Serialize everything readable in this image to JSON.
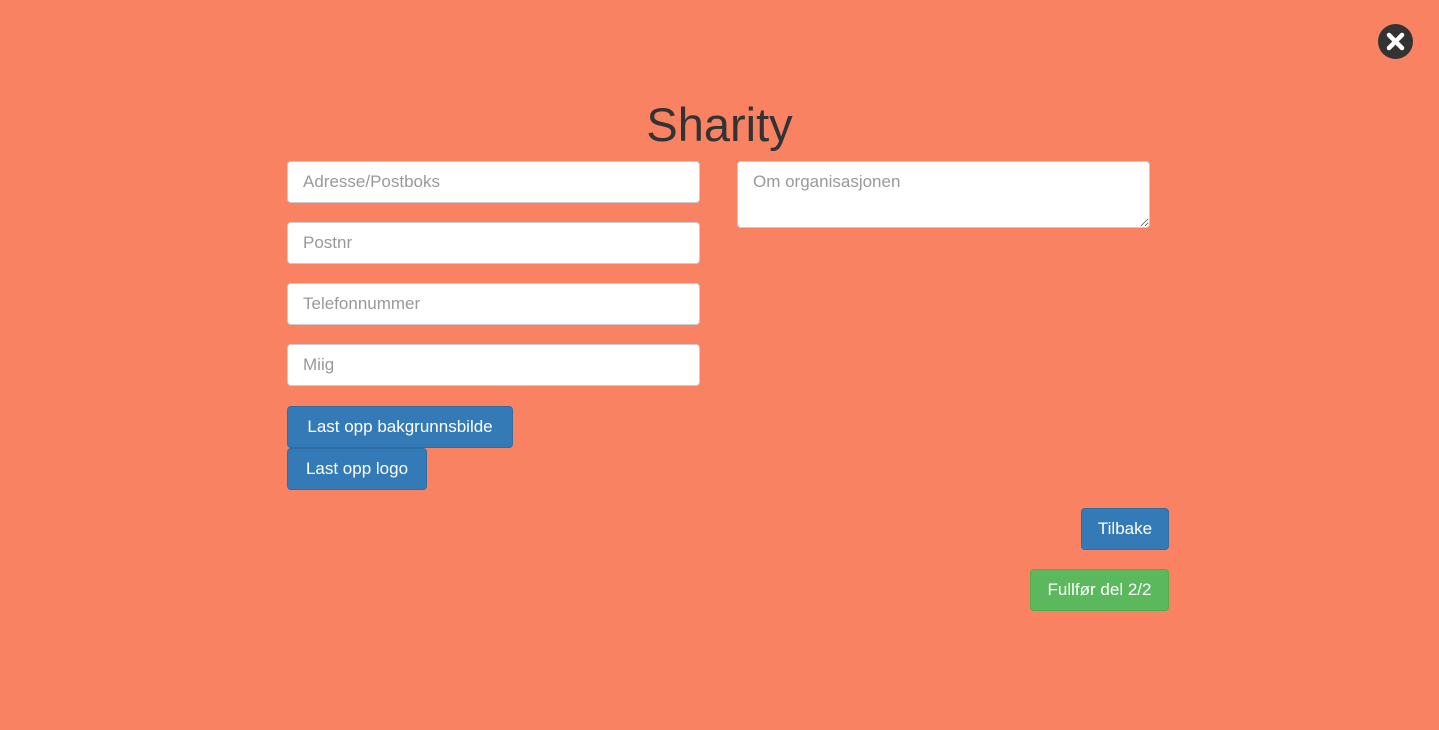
{
  "close": {
    "icon": "close-icon"
  },
  "title": "Sharity",
  "form": {
    "address": {
      "placeholder": "Adresse/Postboks",
      "value": ""
    },
    "postnr": {
      "placeholder": "Postnr",
      "value": ""
    },
    "phone": {
      "placeholder": "Telefonnummer",
      "value": ""
    },
    "miig": {
      "placeholder": "Miig",
      "value": ""
    },
    "about": {
      "placeholder": "Om organisasjonen",
      "value": ""
    }
  },
  "buttons": {
    "upload_background": "Last opp bakgrunnsbilde",
    "upload_logo": "Last opp logo",
    "back": "Tilbake",
    "finish": "Fullfør del 2/2"
  },
  "colors": {
    "background": "#f98262",
    "primary": "#337ab7",
    "success": "#5cb85c",
    "title": "#333333"
  }
}
